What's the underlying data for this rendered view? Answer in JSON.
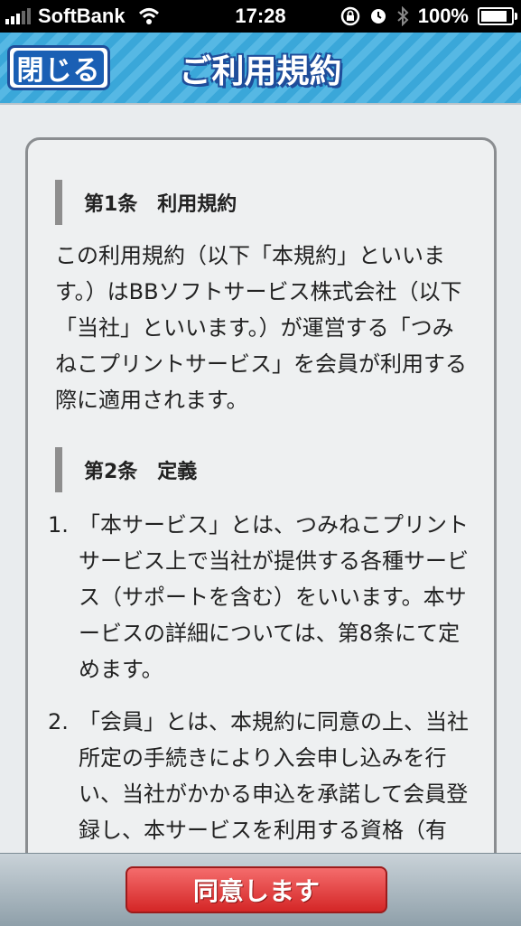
{
  "status_bar": {
    "carrier": "SoftBank",
    "time": "17:28",
    "battery": "100%",
    "battery_level": 1.0
  },
  "nav": {
    "close_label": "閉じる",
    "title": "ご利用規約"
  },
  "terms": {
    "article1": {
      "heading": "第1条　利用規約",
      "body": "この利用規約（以下「本規約」といいます。）はBBソフトサービス株式会社（以下「当社」といいます。）が運営する「つみねこプリントサービス」を会員が利用する際に適用されます。"
    },
    "article2": {
      "heading": "第2条　定義",
      "items": [
        {
          "num": "1.",
          "text": "「本サービス」とは、つみねこプリントサービス上で当社が提供する各種サービス（サポートを含む）をいいます。本サービスの詳細については、第8条にて定めます。"
        },
        {
          "num": "2.",
          "text": "「会員」とは、本規約に同意の上、当社所定の手続きにより入会申し込みを行い、当社がかかる申込を承諾して会員登録し、本サービスを利用する資格（有償・無償を問いません。）を取得"
        }
      ]
    }
  },
  "footer": {
    "agree_label": "同意します"
  }
}
